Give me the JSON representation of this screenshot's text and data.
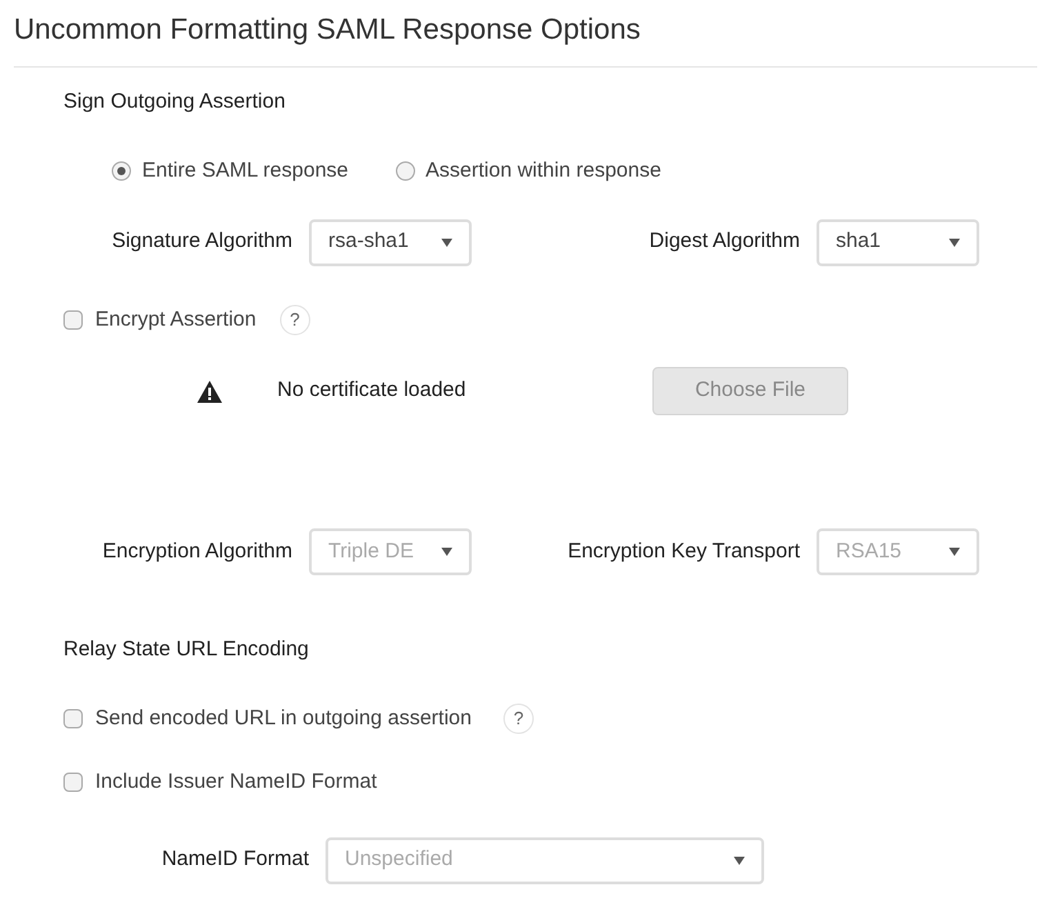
{
  "title": "Uncommon Formatting SAML Response Options",
  "sign_section": {
    "heading": "Sign Outgoing Assertion",
    "radios": [
      {
        "label": "Entire SAML response",
        "selected": true
      },
      {
        "label": "Assertion within response",
        "selected": false
      }
    ],
    "selects": [
      {
        "label": "Signature Algorithm",
        "value": "rsa-sha1",
        "disabled": false
      },
      {
        "label": "Digest Algorithm",
        "value": "sha1",
        "disabled": false
      }
    ]
  },
  "encrypt": {
    "label": "Encrypt Assertion",
    "checked": false,
    "help": "?",
    "certificate_status": "No certificate loaded",
    "choose_file": {
      "label": "Choose File",
      "disabled": true
    },
    "selects": [
      {
        "label": "Encryption Algorithm",
        "value": "Triple DE",
        "disabled": true
      },
      {
        "label": "Encryption Key Transport",
        "value": "RSA15",
        "disabled": true
      }
    ]
  },
  "relay_section": {
    "heading": "Relay State URL Encoding",
    "checkboxes": [
      {
        "label": "Send encoded URL in outgoing assertion",
        "checked": false,
        "help": "?"
      },
      {
        "label": "Include Issuer NameID Format",
        "checked": false
      }
    ],
    "nameid": {
      "label": "NameID Format",
      "value": "Unspecified",
      "disabled": true
    }
  }
}
